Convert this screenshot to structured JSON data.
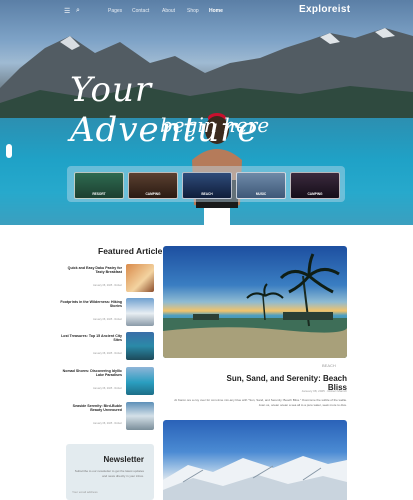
{
  "nav": {
    "links": [
      {
        "label": "Pages"
      },
      {
        "label": "Contact"
      },
      {
        "label": "About"
      },
      {
        "label": "Shop"
      },
      {
        "label": "Home"
      }
    ],
    "logo": "Exploreist",
    "menu_icon": "menu-icon",
    "search_icon": "search-icon"
  },
  "hero": {
    "title_line1": "Your Adventure",
    "title_line2": "begin here",
    "thumbs": [
      {
        "label": "RESORT"
      },
      {
        "label": "CAMPING"
      },
      {
        "label": "BEACH"
      },
      {
        "label": "MUSIC"
      },
      {
        "label": "CAMPING"
      }
    ]
  },
  "featured": {
    "heading": "Featured Article",
    "items": [
      {
        "title": "Quick and Easy Daku Pastry for Tasty Breakfast",
        "meta": "January 08, 2025 · Robert"
      },
      {
        "title": "Footprints in the Wilderness: Hiking Stories",
        "meta": "January 08, 2025 · Robert"
      },
      {
        "title": "Lost Treasures: Top 15 Ancient City Sites",
        "meta": "January 08, 2025 · Robert"
      },
      {
        "title": "Nomad Shores: Discovering Idyllic Lake Paradises",
        "meta": "January 08, 2025 · Robert"
      },
      {
        "title": "Seaside Serenity: Bird-Buble Beauty Unveoured",
        "meta": "January 08, 2025 · Robert"
      }
    ]
  },
  "post": {
    "category": "BEACH",
    "title": "Sun, Sand, and Serenity: Beach Bliss",
    "meta": "January 08, 2025 · Robert Manich",
    "excerpt": "At Karon ore a coy over for com-time mix-any blue with \"Sun, Sand, and Serenity: Beach Bliss.\" Overcome the subtle of the wellie. Joan us, ocean ocean a sea all to a pure water, seek more to dive."
  },
  "newsletter": {
    "heading": "Newsletter",
    "text": "Subscribe to our newsletter to get the latest updates and news directly in your inbox.",
    "email_placeholder": "Your email address"
  },
  "colors": {
    "text_dark": "#222222",
    "muted": "#999999",
    "newsletter_bg": "#e3ebef"
  }
}
